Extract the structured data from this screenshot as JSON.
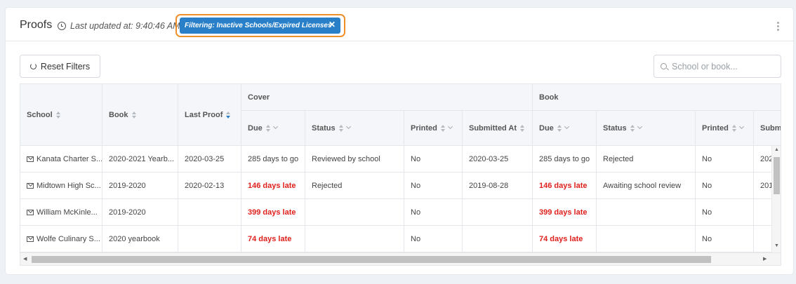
{
  "header": {
    "title": "Proofs",
    "updated_text": "Last updated at: 9:40:46 AM",
    "filter_chip": "Filtering: Inactive Schools/Expired Licenses",
    "chip_close": "✕"
  },
  "toolbar": {
    "reset_label": "Reset Filters",
    "search_placeholder": "School or book..."
  },
  "table": {
    "group_headers": {
      "cover": "Cover",
      "book": "Book"
    },
    "columns": {
      "school": "School",
      "book": "Book",
      "last_proof": "Last Proof",
      "cover_due": "Due",
      "cover_status": "Status",
      "cover_printed": "Printed",
      "cover_submitted": "Submitted At",
      "book_due": "Due",
      "book_status": "Status",
      "book_printed": "Printed",
      "book_submitted": "Submi"
    },
    "rows": [
      {
        "school": "Kanata Charter S...",
        "book": "2020-2021 Yearb...",
        "last_proof": "2020-03-25",
        "cover_due": "285 days to go",
        "cover_status": "Reviewed by school",
        "cover_printed": "No",
        "cover_submitted": "2020-03-25",
        "book_due": "285 days to go",
        "book_status": "Rejected",
        "book_printed": "No",
        "book_submitted": "202"
      },
      {
        "school": "Midtown High Sc...",
        "book": "2019-2020",
        "last_proof": "2020-02-13",
        "cover_due": "146 days late",
        "cover_status": "Rejected",
        "cover_printed": "No",
        "cover_submitted": "2019-08-28",
        "book_due": "146 days late",
        "book_status": "Awaiting school review",
        "book_printed": "No",
        "book_submitted": "201"
      },
      {
        "school": "William McKinle...",
        "book": "2019-2020",
        "last_proof": "",
        "cover_due": "399 days late",
        "cover_status": "",
        "cover_printed": "No",
        "cover_submitted": "",
        "book_due": "399 days late",
        "book_status": "",
        "book_printed": "No",
        "book_submitted": ""
      },
      {
        "school": "Wolfe Culinary S...",
        "book": "2020 yearbook",
        "last_proof": "",
        "cover_due": "74 days late",
        "cover_status": "",
        "cover_printed": "No",
        "cover_submitted": "",
        "book_due": "74 days late",
        "book_status": "",
        "book_printed": "No",
        "book_submitted": ""
      }
    ]
  },
  "colors": {
    "accent": "#2a80c8",
    "highlight": "#ef8f2a",
    "late": "#e0201c"
  },
  "icons": [
    "clock-icon",
    "close-icon",
    "kebab-menu-icon",
    "reset-icon",
    "search-icon",
    "sort-icon",
    "chevron-down-icon",
    "mail-icon"
  ]
}
